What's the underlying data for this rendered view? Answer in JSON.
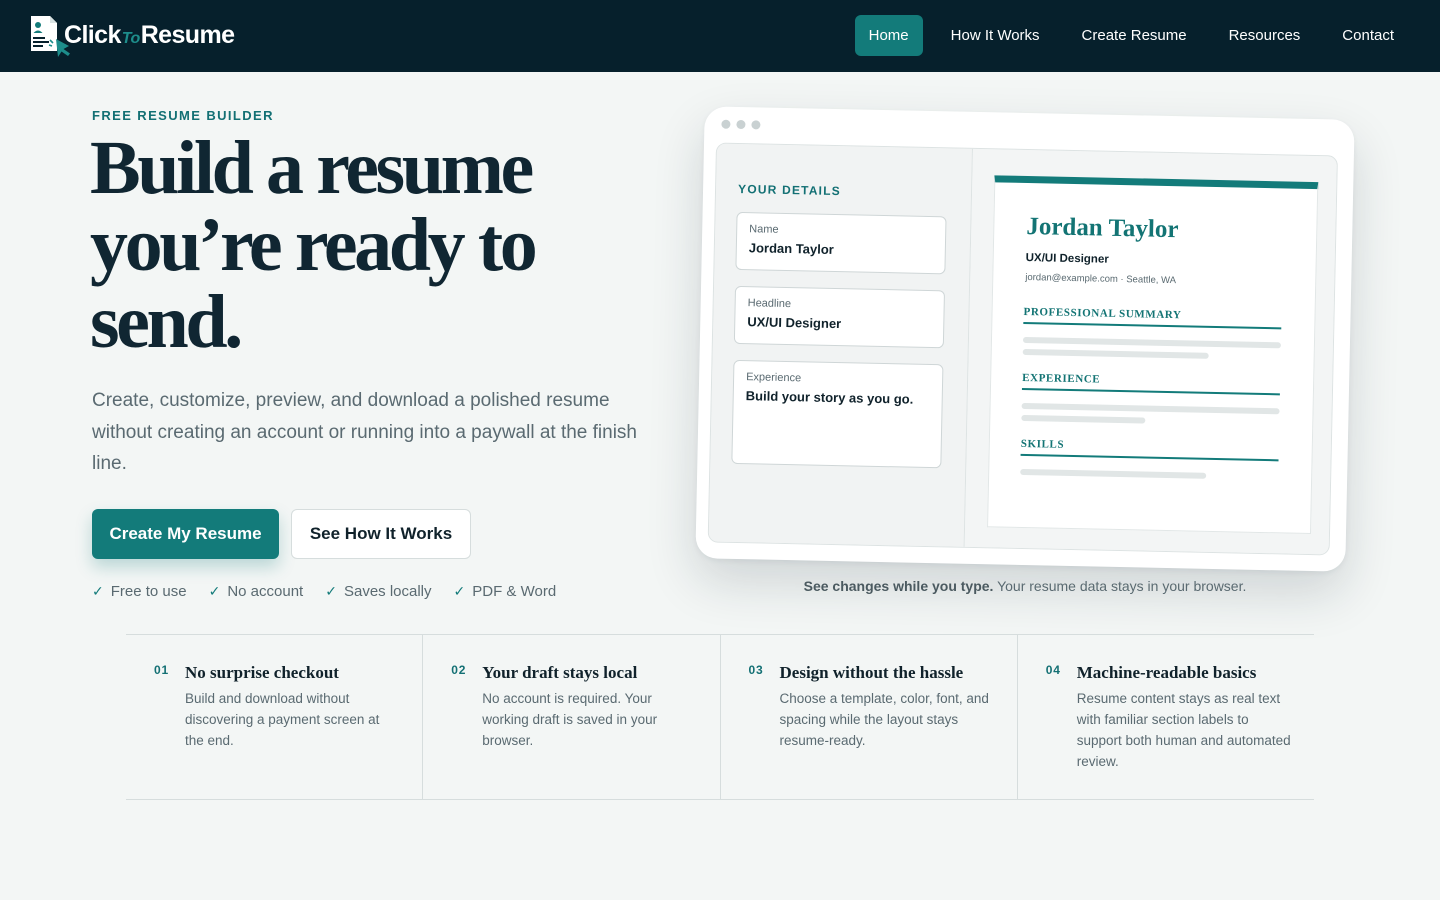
{
  "brand": {
    "name_part1": "Click",
    "name_part2": "To",
    "name_part3": "Resume",
    "colors": {
      "navy": "#06202c",
      "teal": "#137b7a",
      "text": "#10222b",
      "muted": "#5a6a71"
    }
  },
  "nav": {
    "items": [
      {
        "label": "Home",
        "active": true
      },
      {
        "label": "How It Works",
        "active": false
      },
      {
        "label": "Create Resume",
        "active": false
      },
      {
        "label": "Resources",
        "active": false
      },
      {
        "label": "Contact",
        "active": false
      }
    ]
  },
  "hero": {
    "eyebrow": "FREE RESUME BUILDER",
    "title": "Build a resume you’re ready to send.",
    "subtitle": "Create, customize, preview, and download a polished resume without creating an account or running into a paywall at the finish line.",
    "primary_cta": "Create My Resume",
    "secondary_cta": "See How It Works",
    "perks": [
      {
        "icon": "check-icon",
        "label": "Free to use"
      },
      {
        "icon": "check-icon",
        "label": "No account"
      },
      {
        "icon": "check-icon",
        "label": "Saves locally"
      },
      {
        "icon": "check-icon",
        "label": "PDF & Word"
      }
    ]
  },
  "mockup": {
    "form_title": "YOUR DETAILS",
    "fields": [
      {
        "label": "Name",
        "value": "Jordan Taylor"
      },
      {
        "label": "Headline",
        "value": "UX/UI Designer"
      },
      {
        "label": "Experience",
        "value": "Build your story as you go."
      }
    ],
    "resume": {
      "name": "Jordan Taylor",
      "role": "UX/UI Designer",
      "email": "jordan@example.com",
      "separator": "·",
      "location": "Seattle, WA",
      "sections": [
        "PROFESSIONAL SUMMARY",
        "EXPERIENCE",
        "SKILLS"
      ]
    },
    "caption_bold": "See changes while you type.",
    "caption_rest": "Your resume data stays in your browser."
  },
  "features": [
    {
      "number": "01",
      "title": "No surprise checkout",
      "description": "Build and download without discovering a payment screen at the end."
    },
    {
      "number": "02",
      "title": "Your draft stays local",
      "description": "No account is required. Your working draft is saved in your browser."
    },
    {
      "number": "03",
      "title": "Design without the hassle",
      "description": "Choose a template, color, font, and spacing while the layout stays resume-ready."
    },
    {
      "number": "04",
      "title": "Machine-readable basics",
      "description": "Resume content stays as real text with familiar section labels to support both human and automated review."
    }
  ]
}
